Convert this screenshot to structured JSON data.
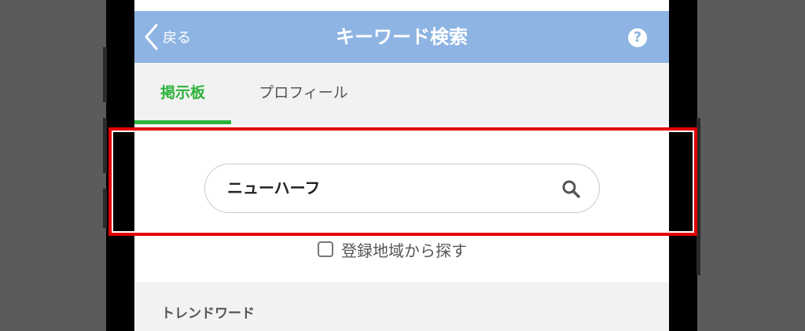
{
  "navbar": {
    "back_label": "戻る",
    "title": "キーワード検索",
    "help_glyph": "?"
  },
  "tabs": [
    {
      "label": "掲示板",
      "active": true
    },
    {
      "label": "プロフィール",
      "active": false
    }
  ],
  "search": {
    "value": "ニューハーフ"
  },
  "region_option": {
    "label": "登録地域から探す",
    "checked": false
  },
  "trend": {
    "label": "トレンドワード"
  },
  "colors": {
    "navbar_bg": "#8eb4e3",
    "tab_active": "#2db33b",
    "highlight": "#e00000"
  }
}
